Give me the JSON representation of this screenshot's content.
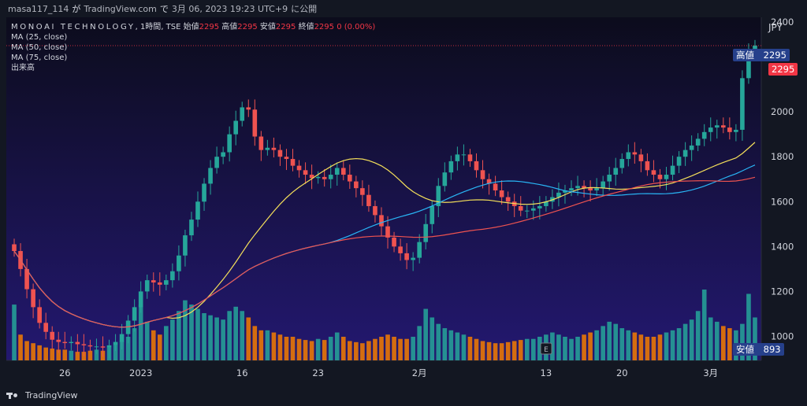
{
  "header": {
    "user": "masa117_114",
    "ga": "が",
    "site": "TradingView.com",
    "de": "で",
    "datetime": "3月 06, 2023 19:23 UTC+9",
    "suffix": "に公開"
  },
  "legend": {
    "symbol": "MONOAI TECHNOLOGY",
    "interval": "1時間",
    "exchange": "TSE",
    "open_label": "始値",
    "open_value": "2295",
    "high_label": "高値",
    "high_value": "2295",
    "low_label": "安値",
    "low_value": "2295",
    "close_label": "終値",
    "close_value": "2295",
    "change": "0 (0.00%)",
    "ma1": "MA (25, close)",
    "ma2": "MA (50, close)",
    "ma3": "MA (75, close)",
    "volume": "出来高"
  },
  "badges": {
    "high_label": "高値",
    "high_value": "2295",
    "last_price": "2295",
    "low_label": "安値",
    "low_value": "893"
  },
  "footer": {
    "brand": "TradingView"
  },
  "colors": {
    "background": "#131722",
    "plot_top": "#0c0c1c",
    "plot_bottom": "#231870",
    "up": "#26a69a",
    "down": "#ef5350",
    "ma25": "#f5e05a",
    "ma50": "#29b6f6",
    "ma75": "#ef5350",
    "vol_up": "#26a69a",
    "vol_down": "#f57c00",
    "badge_blue": "#26408b",
    "badge_red": "#f23645"
  },
  "chart_data": {
    "type": "candlestick",
    "currency": "JPY",
    "ylim": [
      893,
      2400
    ],
    "yticks": [
      1000,
      1200,
      1400,
      1600,
      1800,
      2000,
      2200,
      2400
    ],
    "xticks": [
      {
        "label": "26",
        "idx": 8
      },
      {
        "label": "2023",
        "idx": 20
      },
      {
        "label": "16",
        "idx": 36
      },
      {
        "label": "23",
        "idx": 48
      },
      {
        "label": "2月",
        "idx": 64
      },
      {
        "label": "13",
        "idx": 84
      },
      {
        "label": "20",
        "idx": 96
      },
      {
        "label": "3月",
        "idx": 110
      }
    ],
    "closes": [
      1380,
      1300,
      1210,
      1130,
      1060,
      1020,
      985,
      975,
      970,
      975,
      965,
      960,
      955,
      955,
      950,
      960,
      975,
      1010,
      1070,
      1130,
      1200,
      1250,
      1240,
      1230,
      1250,
      1290,
      1360,
      1450,
      1520,
      1600,
      1680,
      1750,
      1800,
      1820,
      1900,
      1960,
      2020,
      2010,
      1890,
      1830,
      1840,
      1830,
      1800,
      1790,
      1760,
      1740,
      1720,
      1705,
      1710,
      1700,
      1720,
      1750,
      1720,
      1690,
      1660,
      1630,
      1580,
      1540,
      1490,
      1440,
      1400,
      1370,
      1340,
      1350,
      1420,
      1500,
      1580,
      1670,
      1730,
      1780,
      1810,
      1810,
      1780,
      1740,
      1700,
      1680,
      1650,
      1620,
      1600,
      1580,
      1560,
      1560,
      1570,
      1580,
      1600,
      1620,
      1640,
      1650,
      1660,
      1670,
      1660,
      1650,
      1660,
      1690,
      1720,
      1750,
      1790,
      1820,
      1810,
      1780,
      1740,
      1720,
      1700,
      1720,
      1760,
      1800,
      1830,
      1850,
      1880,
      1910,
      1930,
      1940,
      1930,
      1910,
      1920,
      2150,
      2260,
      2295
    ],
    "volumes": [
      260,
      120,
      90,
      80,
      70,
      60,
      55,
      50,
      50,
      45,
      40,
      40,
      45,
      50,
      45,
      60,
      70,
      90,
      110,
      150,
      260,
      180,
      140,
      120,
      160,
      190,
      230,
      280,
      260,
      240,
      220,
      210,
      200,
      190,
      230,
      250,
      230,
      200,
      160,
      140,
      140,
      130,
      120,
      110,
      110,
      100,
      95,
      90,
      100,
      95,
      110,
      130,
      110,
      90,
      85,
      80,
      90,
      100,
      110,
      120,
      110,
      100,
      100,
      110,
      160,
      240,
      200,
      170,
      150,
      140,
      130,
      120,
      110,
      100,
      90,
      85,
      80,
      80,
      85,
      90,
      95,
      100,
      100,
      110,
      120,
      130,
      120,
      110,
      100,
      110,
      120,
      130,
      140,
      160,
      180,
      170,
      150,
      140,
      130,
      120,
      110,
      110,
      120,
      130,
      140,
      150,
      170,
      190,
      230,
      330,
      200,
      180,
      160,
      150,
      140,
      170,
      310,
      200
    ]
  }
}
